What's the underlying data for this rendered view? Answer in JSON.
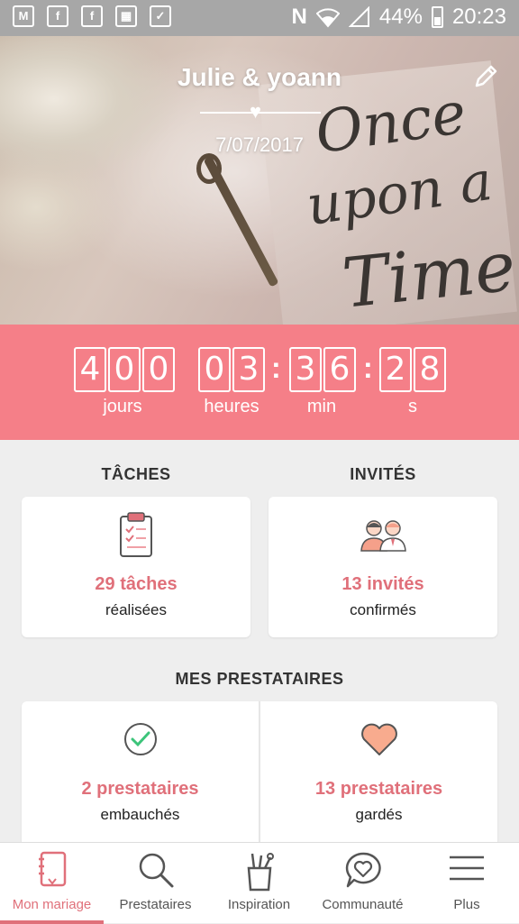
{
  "status_bar": {
    "battery": "44%",
    "time": "20:23",
    "network": "N"
  },
  "hero": {
    "couple": "Julie & yoann",
    "date": "7/07/2017",
    "photo_text": [
      "Once",
      "upon a",
      "Time"
    ]
  },
  "countdown": {
    "digits": [
      "4",
      "0",
      "0",
      "0",
      "3",
      "3",
      "6",
      "2",
      "8"
    ],
    "labels": {
      "days": "jours",
      "hours": "heures",
      "minutes": "min",
      "seconds": "s"
    }
  },
  "tasks": {
    "title": "TÂCHES",
    "value": "29 tâches",
    "sub": "réalisées"
  },
  "guests": {
    "title": "INVITÉS",
    "value": "13 invités",
    "sub": "confirmés"
  },
  "vendors": {
    "title": "MES PRESTATAIRES",
    "hired": {
      "value": "2 prestataires",
      "sub": "embauchés"
    },
    "saved": {
      "value": "13 prestataires",
      "sub": "gardés"
    }
  },
  "nav": {
    "items": [
      {
        "label": "Mon mariage",
        "icon": "notebook-icon",
        "active": true
      },
      {
        "label": "Prestataires",
        "icon": "search-icon"
      },
      {
        "label": "Inspiration",
        "icon": "pencil-cup-icon"
      },
      {
        "label": "Communauté",
        "icon": "chat-heart-icon"
      },
      {
        "label": "Plus",
        "icon": "menu-icon"
      }
    ]
  },
  "colors": {
    "accent": "#f57f88",
    "accent_text": "#e0707a",
    "status_bar": "#a7a7a7",
    "background": "#eeeeee"
  }
}
